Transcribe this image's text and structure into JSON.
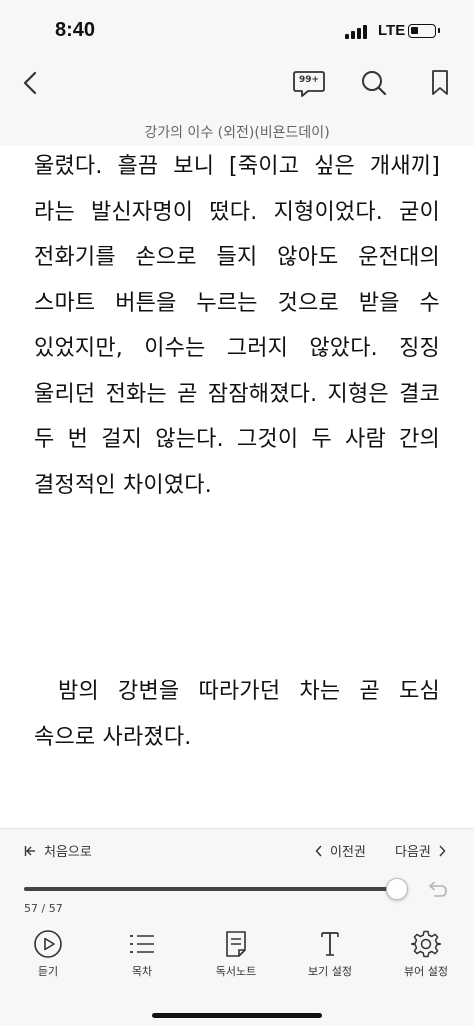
{
  "status": {
    "time": "8:40",
    "network": "LTE",
    "battery_level": 0.35
  },
  "topbar": {
    "comments_badge": "99+"
  },
  "book": {
    "title": "강가의 이수 (외전)(비욘드데이)"
  },
  "content": {
    "paragraphs": [
      "울렸다. 흘끔 보니 [죽이고 싶은 개새끼]라는 발신자명이 떴다. 지형이었다. 굳이 전화기를 손으로 들지 않아도 운전대의 스마트 버튼을 누르는 것으로 받을 수 있었지만, 이수는 그러지 않았다. 징징 울리던 전화는 곧 잠잠해졌다. 지형은 결코 두 번 걸지 않는다. 그것이 두 사람 간의 결정적인 차이였다.",
      "밤의 강변을 따라가던 차는 곧 도심 속으로 사라졌다."
    ]
  },
  "navigation": {
    "first": "처음으로",
    "prev": "이전권",
    "next": "다음권"
  },
  "progress": {
    "current": 57,
    "total": 57,
    "label": "57 / 57"
  },
  "tabs": [
    {
      "label": "듣기",
      "icon": "play-circle-icon"
    },
    {
      "label": "목차",
      "icon": "list-icon"
    },
    {
      "label": "독서노트",
      "icon": "note-icon"
    },
    {
      "label": "보기 설정",
      "icon": "text-settings-icon"
    },
    {
      "label": "뷰어 설정",
      "icon": "gear-icon"
    }
  ]
}
